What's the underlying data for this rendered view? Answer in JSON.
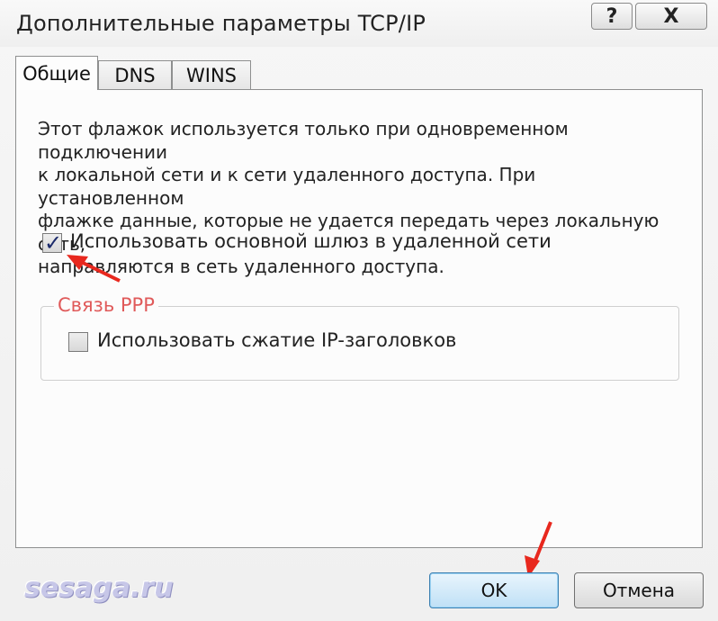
{
  "window": {
    "title": "Дополнительные параметры TCP/IP",
    "help_label": "?",
    "close_label": "X"
  },
  "tabs": [
    {
      "label": "Общие",
      "active": true
    },
    {
      "label": "DNS",
      "active": false
    },
    {
      "label": "WINS",
      "active": false
    }
  ],
  "general": {
    "description_lines": [
      "Этот флажок используется только при одновременном подключении",
      "к локальной сети и к сети удаленного доступа. При установленном",
      "флажке данные, которые не удается передать через локальную сеть,",
      "направляются в сеть удаленного доступа."
    ],
    "use_remote_gateway": {
      "label": "Использовать основной шлюз в удаленной сети",
      "checked": true
    },
    "ppp_group": {
      "legend": "Связь PPP",
      "ip_header_compression": {
        "label": "Использовать сжатие IP-заголовков",
        "checked": false
      }
    }
  },
  "buttons": {
    "ok": "OK",
    "cancel": "Отмена"
  },
  "watermark": "sesaga.ru",
  "colors": {
    "annotation_arrow": "#e8281e",
    "group_legend": "#e05a5a",
    "ok_accent": "#bfe0f6"
  }
}
